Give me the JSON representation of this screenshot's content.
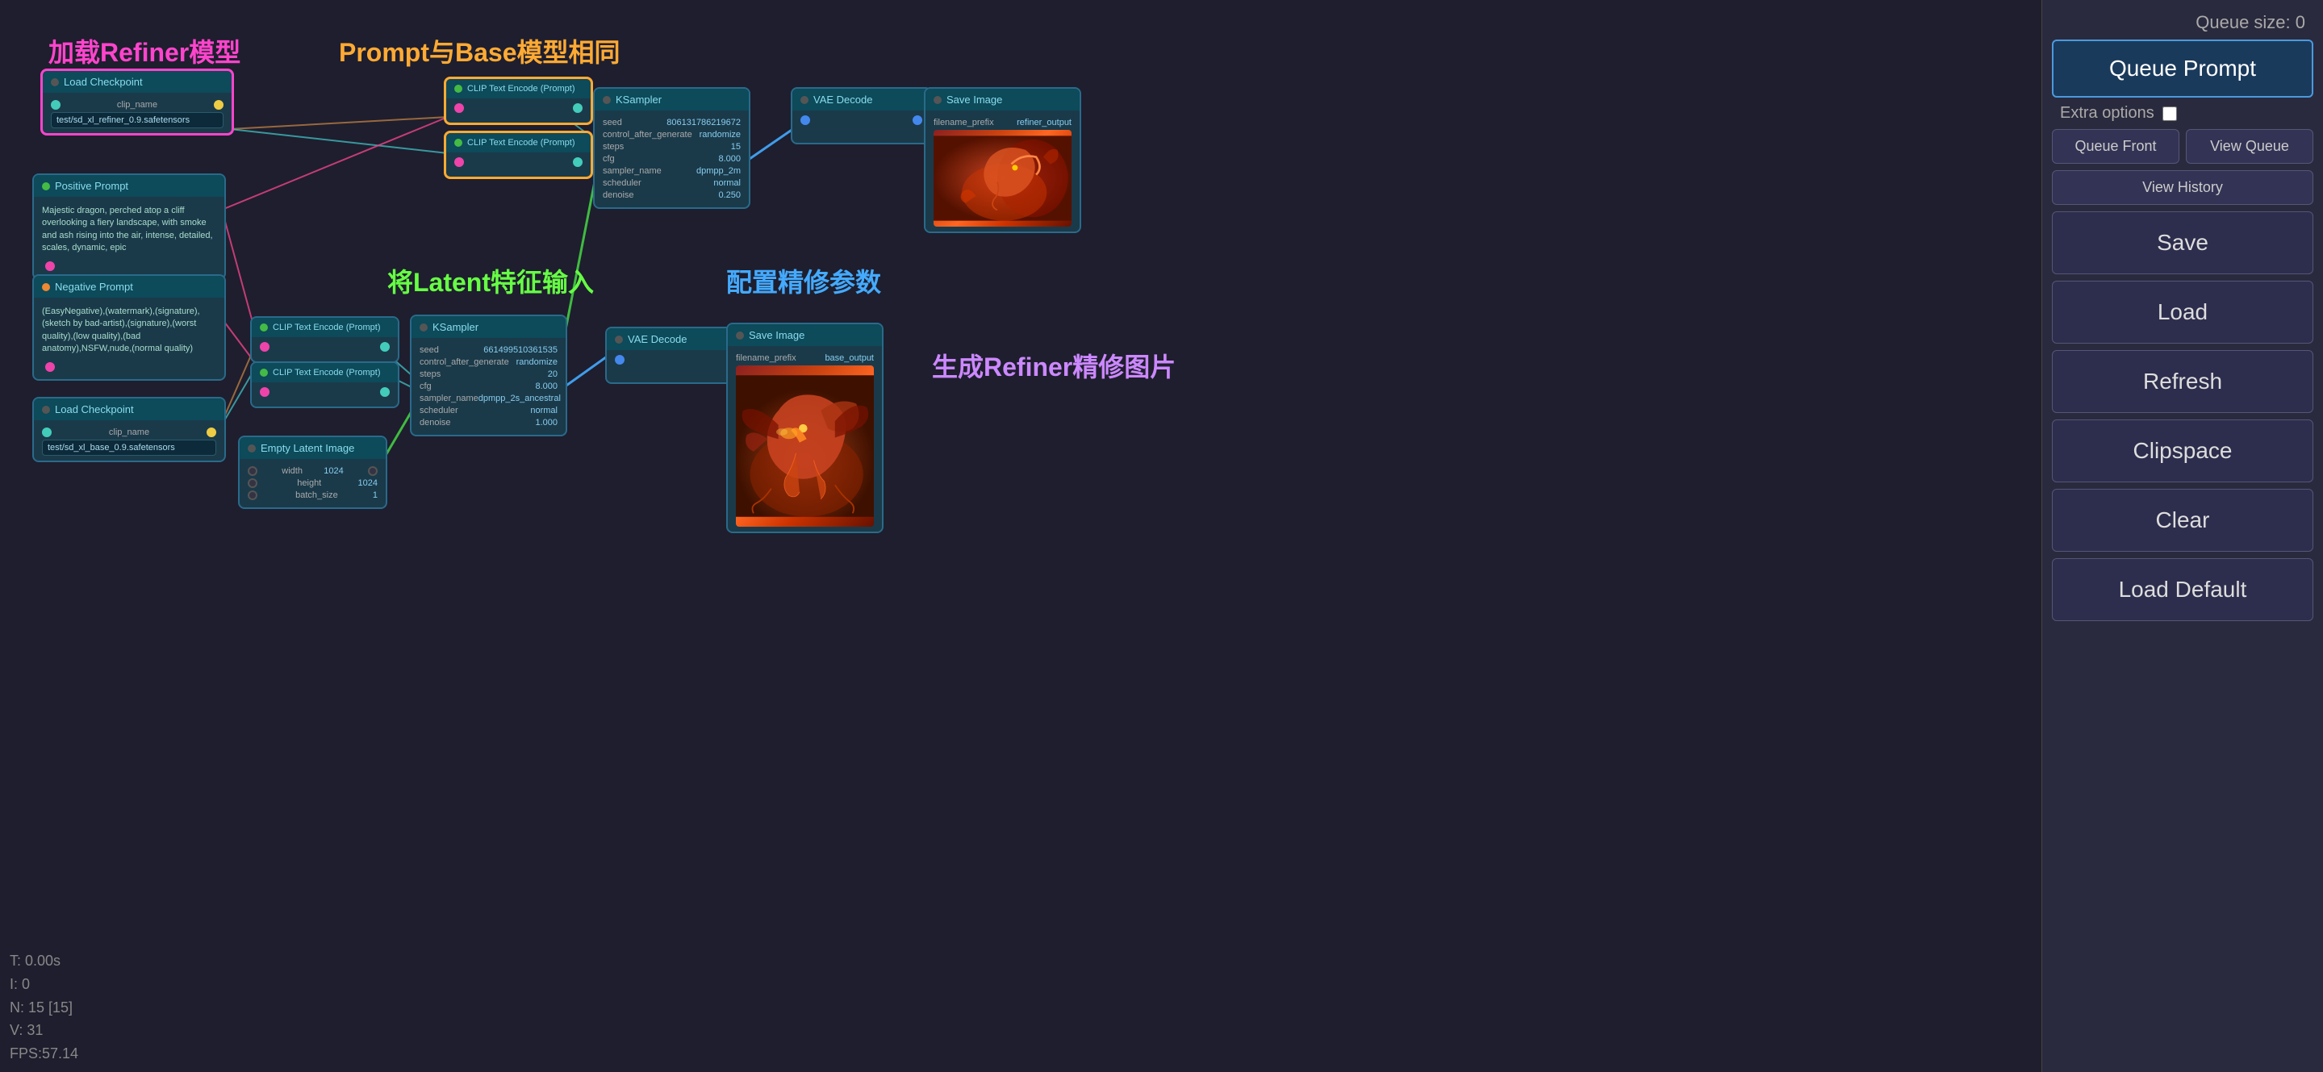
{
  "panel": {
    "queue_size_label": "Queue size: 0",
    "queue_prompt_label": "Queue Prompt",
    "extra_options_label": "Extra options",
    "queue_front_label": "Queue Front",
    "view_queue_label": "View Queue",
    "save_label": "Save",
    "load_label": "Load",
    "refresh_label": "Refresh",
    "clipspace_label": "Clipspace",
    "clear_label": "Clear",
    "load_default_label": "Load Default",
    "view_history_label": "View History"
  },
  "annotations": {
    "load_refiner": "加载Refiner模型",
    "same_prompt": "Prompt与Base模型相同",
    "latent_input": "将Latent特征输入",
    "config_params": "配置精修参数",
    "generate_refiner": "生成Refiner精修图片"
  },
  "statusbar": {
    "t": "T: 0.00s",
    "i": "I: 0",
    "n": "N: 15 [15]",
    "v": "V: 31",
    "fps": "FPS:57.14"
  },
  "nodes": {
    "load_checkpoint_refiner": {
      "title": "Load Checkpoint",
      "field": "clip_name",
      "value": "test/sd_xl_refiner_0.9.safetensors"
    },
    "positive_prompt": {
      "title": "Positive Prompt",
      "text": "Majestic dragon, perched atop a cliff overlooking a fiery landscape, with smoke and ash rising into the air, intense, detailed, scales, dynamic, epic"
    },
    "negative_prompt": {
      "title": "Negative Prompt",
      "text": "(EasyNegative),(watermark),(signature),(sketch by bad-artist),(signature),(worst quality),(low quality),(bad anatomy),NSFW,nude,(normal quality)"
    },
    "load_checkpoint_base": {
      "title": "Load Checkpoint",
      "field": "clip_name",
      "value": "test/sd_xl_base_0.9.safetensors"
    },
    "clip_encode_1": {
      "title": "CLIP Text Encode (Prompt)"
    },
    "clip_encode_2": {
      "title": "CLIP Text Encode (Prompt)"
    },
    "clip_encode_3": {
      "title": "CLIP Text Encode (Prompt)"
    },
    "clip_encode_4": {
      "title": "CLIP Text Encode (Prompt)"
    },
    "ksampler_refiner": {
      "title": "KSampler",
      "seed": "806131786219672",
      "control_after": "randomize",
      "steps": "15",
      "cfg": "8.000",
      "sampler_name": "dpmpp_2m",
      "scheduler": "normal",
      "denoise": "0.250"
    },
    "ksampler_base": {
      "title": "KSampler",
      "seed": "661499510361535",
      "control_after": "randomize",
      "steps": "20",
      "cfg": "8.000",
      "sampler_name": "dpmpp_2s_ancestral",
      "scheduler": "normal",
      "denoise": "1.000"
    },
    "vae_decode_refiner": {
      "title": "VAE Decode"
    },
    "vae_decode_base": {
      "title": "VAE Decode"
    },
    "save_image_refiner": {
      "title": "Save Image",
      "field": "filename_prefix",
      "value": "refiner_output"
    },
    "save_image_base": {
      "title": "Save Image",
      "field": "filename_prefix",
      "value": "base_output"
    },
    "empty_latent": {
      "title": "Empty Latent Image",
      "width": "1024",
      "height": "1024",
      "batch_size": "1"
    }
  }
}
